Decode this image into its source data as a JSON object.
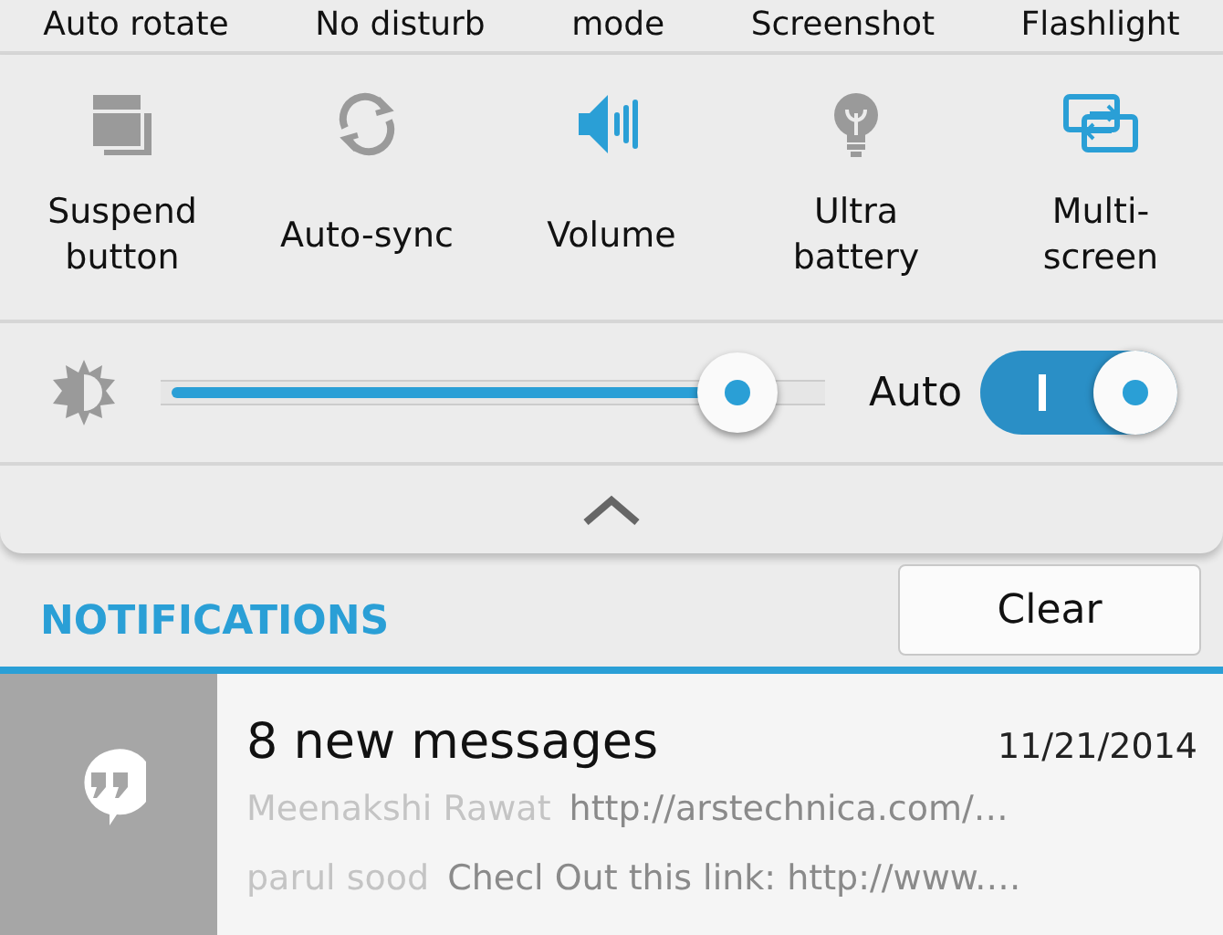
{
  "top_row": [
    "Auto rotate",
    "No disturb",
    "mode",
    "Screenshot",
    "Flashlight"
  ],
  "tiles": [
    {
      "kind": "suspend",
      "label": "Suspend button",
      "on": false
    },
    {
      "kind": "sync",
      "label": "Auto-sync",
      "on": false
    },
    {
      "kind": "volume",
      "label": "Volume",
      "on": true
    },
    {
      "kind": "bulb",
      "label": "Ultra battery",
      "on": false
    },
    {
      "kind": "multiscreen",
      "label": "Multi-screen",
      "on": true
    }
  ],
  "brightness": {
    "level": 0.92,
    "auto_label": "Auto",
    "auto_on": true
  },
  "notifications": {
    "title": "NOTIFICATIONS",
    "clear": "Clear",
    "items": [
      {
        "title": "8 new messages",
        "time": "11/21/2014",
        "lines": [
          {
            "sender": "Meenakshi Rawat",
            "text": "http://arstechnica.com/…"
          },
          {
            "sender": "parul sood",
            "text": "Checl Out this link:  http://www.…"
          }
        ]
      }
    ]
  }
}
